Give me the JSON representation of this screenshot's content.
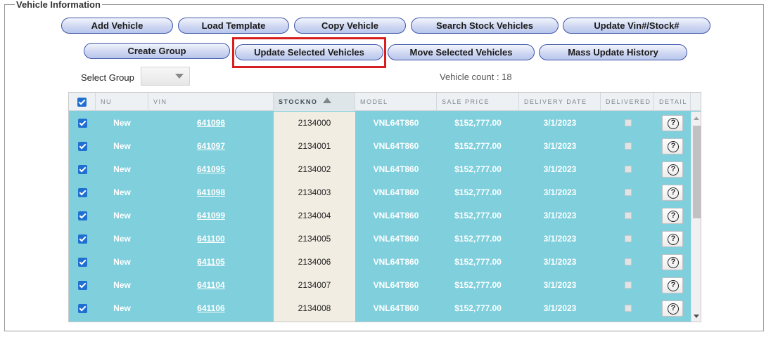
{
  "section": {
    "title": "Vehicle Information"
  },
  "toolbar": {
    "add_vehicle": "Add Vehicle",
    "load_template": "Load Template",
    "copy_vehicle": "Copy Vehicle",
    "search_stock_vehicles": "Search Stock Vehicles",
    "update_vin_stock": "Update Vin#/Stock#",
    "create_group": "Create Group",
    "update_selected_vehicles": "Update Selected Vehicles",
    "move_selected_vehicles": "Move Selected Vehicles",
    "mass_update_history": "Mass Update History"
  },
  "select_group": {
    "label": "Select Group",
    "value": ""
  },
  "vehicle_count": "Vehicle count : 18",
  "grid": {
    "columns": {
      "nu": "NU",
      "vin": "VIN",
      "stockno": "STOCKNO",
      "model": "MODEL",
      "sale_price": "SALE PRICE",
      "delivery_date": "DELIVERY DATE",
      "delivered": "DELIVERED",
      "detail": "DETAIL"
    },
    "sort": {
      "column": "STOCKNO",
      "direction": "ascending"
    },
    "rows": [
      {
        "nu": "New",
        "vin": "641096",
        "stockno": "2134000",
        "model": "VNL64T860",
        "sale_price": "$152,777.00",
        "delivery_date": "3/1/2023",
        "selected": true,
        "delivered": false
      },
      {
        "nu": "New",
        "vin": "641097",
        "stockno": "2134001",
        "model": "VNL64T860",
        "sale_price": "$152,777.00",
        "delivery_date": "3/1/2023",
        "selected": true,
        "delivered": false
      },
      {
        "nu": "New",
        "vin": "641095",
        "stockno": "2134002",
        "model": "VNL64T860",
        "sale_price": "$152,777.00",
        "delivery_date": "3/1/2023",
        "selected": true,
        "delivered": false
      },
      {
        "nu": "New",
        "vin": "641098",
        "stockno": "2134003",
        "model": "VNL64T860",
        "sale_price": "$152,777.00",
        "delivery_date": "3/1/2023",
        "selected": true,
        "delivered": false
      },
      {
        "nu": "New",
        "vin": "641099",
        "stockno": "2134004",
        "model": "VNL64T860",
        "sale_price": "$152,777.00",
        "delivery_date": "3/1/2023",
        "selected": true,
        "delivered": false
      },
      {
        "nu": "New",
        "vin": "641100",
        "stockno": "2134005",
        "model": "VNL64T860",
        "sale_price": "$152,777.00",
        "delivery_date": "3/1/2023",
        "selected": true,
        "delivered": false
      },
      {
        "nu": "New",
        "vin": "641105",
        "stockno": "2134006",
        "model": "VNL64T860",
        "sale_price": "$152,777.00",
        "delivery_date": "3/1/2023",
        "selected": true,
        "delivered": false
      },
      {
        "nu": "New",
        "vin": "641104",
        "stockno": "2134007",
        "model": "VNL64T860",
        "sale_price": "$152,777.00",
        "delivery_date": "3/1/2023",
        "selected": true,
        "delivered": false
      },
      {
        "nu": "New",
        "vin": "641106",
        "stockno": "2134008",
        "model": "VNL64T860",
        "sale_price": "$152,777.00",
        "delivery_date": "3/1/2023",
        "selected": true,
        "delivered": false
      }
    ]
  },
  "colors": {
    "row_background": "#7fcfdc",
    "stock_column_background": "#f2ede3",
    "checkbox": "#1f6fd1",
    "highlight_box": "#d81e1e",
    "button_border": "#3f55a8"
  },
  "icons": {
    "sort": "sort-ascending-icon",
    "detail": "help-icon",
    "select": "chevron-down-icon"
  }
}
